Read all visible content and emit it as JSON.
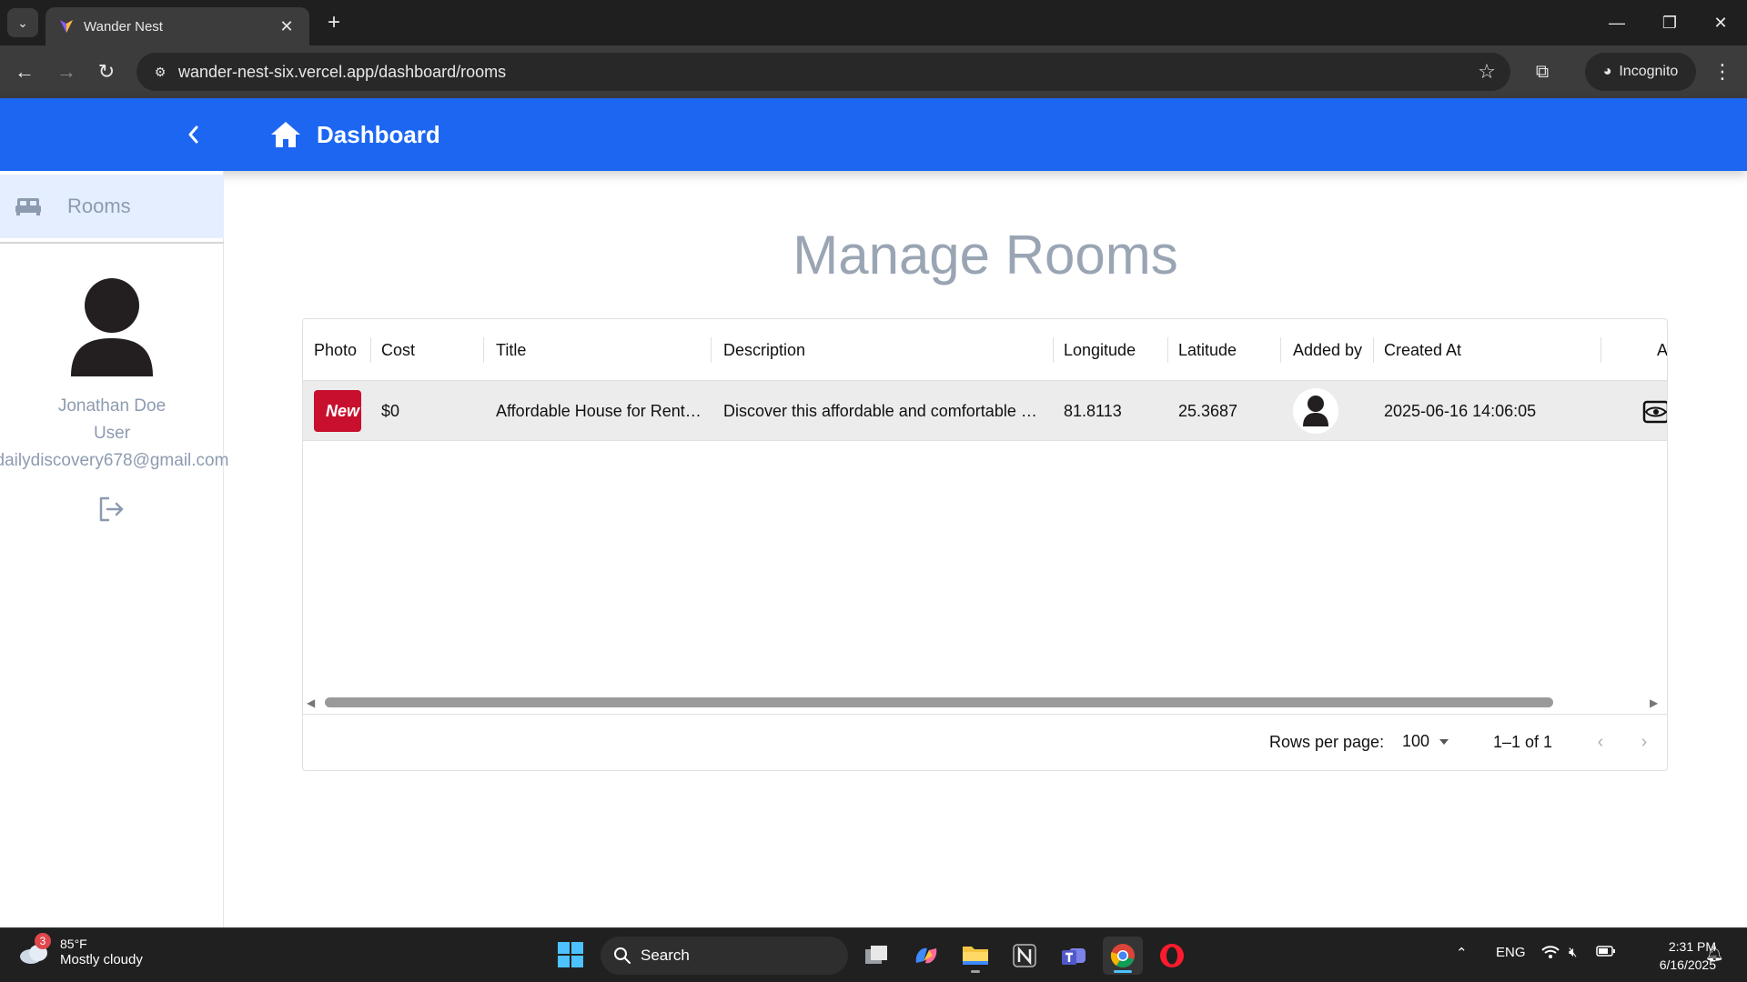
{
  "browser": {
    "tab_title": "Wander Nest",
    "url": "wander-nest-six.vercel.app/dashboard/rooms",
    "incognito_label": "Incognito"
  },
  "header": {
    "title": "Dashboard",
    "color": "#1c66f2"
  },
  "sidebar": {
    "nav_items": [
      {
        "label": "Rooms",
        "icon": "bed-icon",
        "active": true
      }
    ],
    "user": {
      "name": "Jonathan Doe",
      "role": "User",
      "email": "dailydiscovery678@gmail.com"
    }
  },
  "main": {
    "heading": "Manage Rooms",
    "table": {
      "columns": [
        "Photo",
        "Cost",
        "Title",
        "Description",
        "Longitude",
        "Latitude",
        "Added by",
        "Created At",
        "A"
      ],
      "rows": [
        {
          "photo_text": "New",
          "cost": "$0",
          "title": "Affordable House for Rent…",
          "description": "Discover this affordable and comfortable …",
          "longitude": "81.8113",
          "latitude": "25.3687",
          "added_by": "user-avatar",
          "created_at": "2025-06-16 14:06:05",
          "action": "view-icon"
        }
      ]
    },
    "pagination": {
      "rows_per_page_label": "Rows per page:",
      "rows_per_page_value": "100",
      "range": "1–1 of 1"
    }
  },
  "taskbar": {
    "weather": {
      "badge": "3",
      "temp": "85°F",
      "condition": "Mostly cloudy"
    },
    "search_placeholder": "Search",
    "language": "ENG",
    "time": "2:31 PM",
    "date": "6/16/2025"
  }
}
